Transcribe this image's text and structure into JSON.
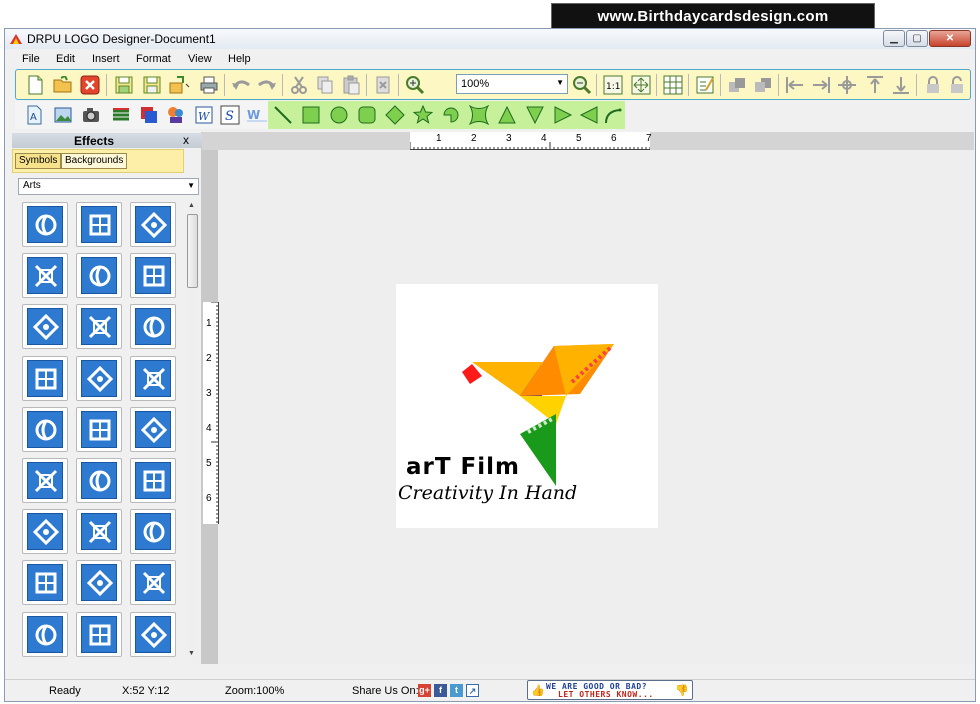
{
  "banner": {
    "url": "www.Birthdaycardsdesign.com"
  },
  "window": {
    "title": "DRPU LOGO Designer-Document1"
  },
  "menu": [
    "File",
    "Edit",
    "Insert",
    "Format",
    "View",
    "Help"
  ],
  "toolbar": {
    "zoom_value": "100%",
    "icons": [
      "new-icon",
      "open-icon",
      "close-icon",
      "save-icon",
      "save-as-icon",
      "export-icon",
      "print-icon",
      "undo-icon",
      "redo-icon",
      "cut-icon",
      "copy-icon",
      "paste-icon",
      "delete-icon",
      "zoom-in-icon",
      "zoom-out-icon",
      "actual-size-icon",
      "fit-icon",
      "grid-icon",
      "properties-icon",
      "bring-front-icon",
      "send-back-icon",
      "align-left-icon",
      "align-right-icon",
      "align-center-icon",
      "align-top-icon",
      "align-bottom-icon",
      "lock-icon",
      "unlock-icon"
    ]
  },
  "shapes_toolbar": {
    "icons": [
      "text-icon",
      "image-icon",
      "camera-icon",
      "layers-icon",
      "duplicate-icon",
      "symbols-icon",
      "wordart-icon",
      "signature-icon",
      "watermark-icon",
      "line-icon",
      "rectangle-icon",
      "ellipse-icon",
      "rounded-rectangle-icon",
      "diamond-icon",
      "star-icon",
      "arc-icon",
      "curved-star-icon",
      "triangle-icon",
      "triangle-down-icon",
      "triangle-right-icon",
      "triangle-left-icon",
      "curve-icon"
    ]
  },
  "effects": {
    "title": "Effects",
    "close_label": "x",
    "tabs": [
      "Symbols",
      "Backgrounds"
    ],
    "category": "Arts"
  },
  "ruler": {
    "h_numbers": [
      "1",
      "2",
      "3",
      "4",
      "5",
      "6",
      "7"
    ],
    "v_numbers": [
      "1",
      "2",
      "3",
      "4",
      "5",
      "6"
    ]
  },
  "logo": {
    "title": "arT Film",
    "tagline": "Creativity In Hand"
  },
  "status": {
    "state": "Ready",
    "coords": "X:52  Y:12",
    "zoom": "Zoom:100%",
    "share_label": "Share Us On:",
    "feedback_line1": "WE ARE GOOD OR BAD?",
    "feedback_line2": "LET OTHERS KNOW..."
  },
  "colors": {
    "accent_yellow": "#fdf7c4",
    "shape_bar": "#c6f09a",
    "symbol_blue": "#2d7ad0"
  }
}
